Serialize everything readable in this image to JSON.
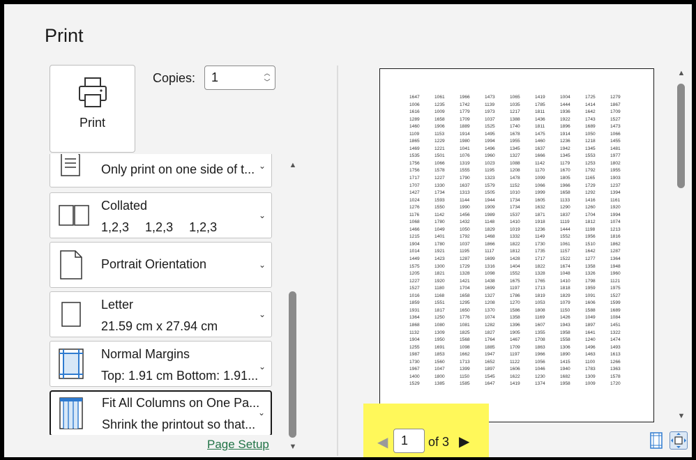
{
  "page": {
    "title": "Print"
  },
  "print_button": {
    "label": "Print",
    "icon": "printer-icon"
  },
  "copies": {
    "label": "Copies:",
    "value": "1"
  },
  "settings": [
    {
      "name": "sides",
      "icon": "one-sided-icon",
      "line1": "",
      "line2": "Only print on one side of t..."
    },
    {
      "name": "collation",
      "icon": "collated-icon",
      "line1": "Collated",
      "line2_items": [
        "1,2,3",
        "1,2,3",
        "1,2,3"
      ]
    },
    {
      "name": "orientation",
      "icon": "portrait-page-icon",
      "line1": "Portrait Orientation",
      "line2": ""
    },
    {
      "name": "paper-size",
      "icon": "letter-page-icon",
      "line1": "Letter",
      "line2": "21.59 cm x 27.94 cm"
    },
    {
      "name": "margins",
      "icon": "margins-icon",
      "line1": "Normal Margins",
      "line2": "Top: 1.91 cm Bottom: 1.91..."
    },
    {
      "name": "scaling",
      "icon": "fit-columns-icon",
      "line1": "Fit All Columns on One Pa...",
      "line2": "Shrink the printout so that..."
    }
  ],
  "page_setup_link": "Page Setup",
  "preview": {
    "rows": [
      [
        "1647",
        "1061",
        "1966",
        "1473",
        "1065",
        "1419",
        "1004",
        "1725",
        "1279"
      ],
      [
        "1006",
        "1235",
        "1742",
        "1139",
        "1035",
        "1785",
        "1444",
        "1414",
        "1867"
      ],
      [
        "1616",
        "1009",
        "1779",
        "1973",
        "1217",
        "1811",
        "1936",
        "1642",
        "1709"
      ],
      [
        "1289",
        "1658",
        "1709",
        "1037",
        "1388",
        "1436",
        "1922",
        "1743",
        "1527"
      ],
      [
        "1460",
        "1906",
        "1889",
        "1525",
        "1740",
        "1811",
        "1896",
        "1689",
        "1473"
      ],
      [
        "1109",
        "1153",
        "1914",
        "1495",
        "1678",
        "1475",
        "1914",
        "1050",
        "1066"
      ],
      [
        "1865",
        "1229",
        "1980",
        "1994",
        "1955",
        "1460",
        "1236",
        "1218",
        "1455"
      ],
      [
        "1469",
        "1221",
        "1041",
        "1496",
        "1345",
        "1637",
        "1942",
        "1345",
        "1481"
      ],
      [
        "1535",
        "1501",
        "1076",
        "1960",
        "1327",
        "1666",
        "1345",
        "1553",
        "1977"
      ],
      [
        "1756",
        "1066",
        "1319",
        "1023",
        "1088",
        "1142",
        "1179",
        "1253",
        "1802"
      ],
      [
        "1756",
        "1578",
        "1555",
        "1195",
        "1208",
        "1170",
        "1670",
        "1792",
        "1955"
      ],
      [
        "1717",
        "1227",
        "1790",
        "1323",
        "1478",
        "1099",
        "1805",
        "1165",
        "1903"
      ],
      [
        "1707",
        "1330",
        "1637",
        "1579",
        "1152",
        "1066",
        "1966",
        "1729",
        "1237"
      ],
      [
        "1427",
        "1734",
        "1313",
        "1505",
        "1010",
        "1999",
        "1658",
        "1292",
        "1394"
      ],
      [
        "1024",
        "1593",
        "1144",
        "1944",
        "1734",
        "1605",
        "1133",
        "1416",
        "1161"
      ],
      [
        "1276",
        "1550",
        "1990",
        "1909",
        "1734",
        "1632",
        "1290",
        "1260",
        "1920"
      ],
      [
        "1176",
        "1142",
        "1456",
        "1989",
        "1537",
        "1871",
        "1837",
        "1704",
        "1994"
      ],
      [
        "1068",
        "1780",
        "1432",
        "1148",
        "1410",
        "1918",
        "1119",
        "1812",
        "1074"
      ],
      [
        "1466",
        "1049",
        "1050",
        "1829",
        "1019",
        "1236",
        "1444",
        "1198",
        "1213"
      ],
      [
        "1215",
        "1401",
        "1792",
        "1468",
        "1332",
        "1149",
        "1552",
        "1956",
        "1816"
      ],
      [
        "1904",
        "1780",
        "1037",
        "1866",
        "1822",
        "1730",
        "1061",
        "1510",
        "1862"
      ],
      [
        "1014",
        "1921",
        "1195",
        "1117",
        "1812",
        "1735",
        "1157",
        "1642",
        "1287"
      ],
      [
        "1449",
        "1423",
        "1287",
        "1699",
        "1428",
        "1717",
        "1522",
        "1277",
        "1364"
      ],
      [
        "1575",
        "1300",
        "1729",
        "1316",
        "1404",
        "1822",
        "1674",
        "1358",
        "1948"
      ],
      [
        "1205",
        "1821",
        "1328",
        "1098",
        "1552",
        "1328",
        "1048",
        "1326",
        "1960"
      ],
      [
        "1227",
        "1920",
        "1421",
        "1438",
        "1675",
        "1765",
        "1410",
        "1798",
        "1121"
      ],
      [
        "1527",
        "1180",
        "1704",
        "1699",
        "1197",
        "1713",
        "1818",
        "1959",
        "1975"
      ],
      [
        "1016",
        "1168",
        "1658",
        "1327",
        "1786",
        "1819",
        "1829",
        "1091",
        "1527"
      ],
      [
        "1859",
        "1551",
        "1295",
        "1208",
        "1270",
        "1053",
        "1079",
        "1606",
        "1599"
      ],
      [
        "1931",
        "1817",
        "1650",
        "1370",
        "1586",
        "1808",
        "1150",
        "1588",
        "1689"
      ],
      [
        "1364",
        "1250",
        "1776",
        "1074",
        "1358",
        "1169",
        "1426",
        "1049",
        "1084"
      ],
      [
        "1868",
        "1080",
        "1081",
        "1282",
        "1396",
        "1607",
        "1943",
        "1897",
        "1451"
      ],
      [
        "1132",
        "1309",
        "1825",
        "1827",
        "1905",
        "1355",
        "1958",
        "1641",
        "1322"
      ],
      [
        "1904",
        "1950",
        "1568",
        "1764",
        "1467",
        "1708",
        "1558",
        "1240",
        "1474"
      ],
      [
        "1255",
        "1691",
        "1098",
        "1885",
        "1709",
        "1863",
        "1306",
        "1496",
        "1493"
      ],
      [
        "1987",
        "1853",
        "1662",
        "1947",
        "1197",
        "1966",
        "1890",
        "1463",
        "1613"
      ],
      [
        "1730",
        "1560",
        "1713",
        "1652",
        "1122",
        "1056",
        "1415",
        "1100",
        "1266"
      ],
      [
        "1967",
        "1047",
        "1399",
        "1897",
        "1606",
        "1046",
        "1940",
        "1783",
        "1363"
      ],
      [
        "1400",
        "1800",
        "1150",
        "1545",
        "1622",
        "1230",
        "1682",
        "1309",
        "1578"
      ],
      [
        "1529",
        "1385",
        "1585",
        "1647",
        "1419",
        "1374",
        "1958",
        "1009",
        "1720"
      ]
    ]
  },
  "navigation": {
    "current_page": "1",
    "total_label": "of 3"
  }
}
